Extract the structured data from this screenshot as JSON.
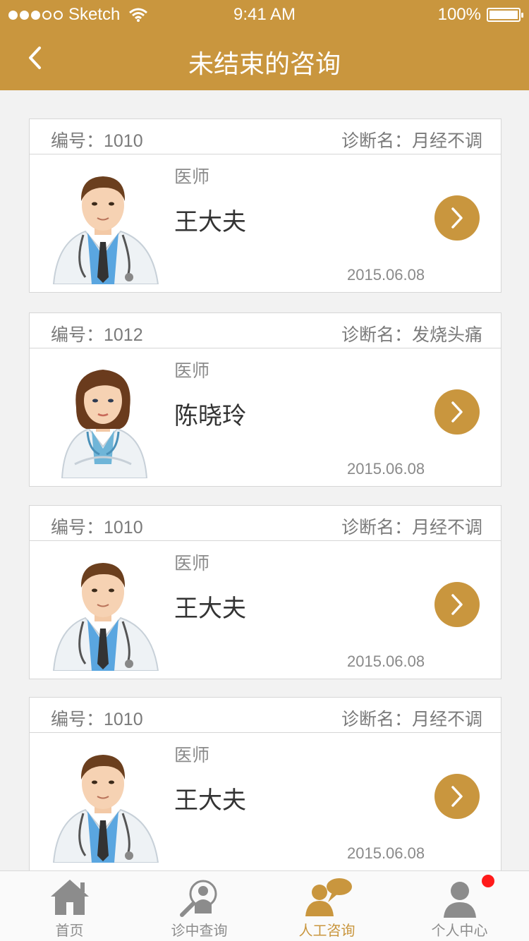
{
  "colors": {
    "accent": "#c9963e",
    "badge": "#ff1a1a",
    "background": "#f2f2f2"
  },
  "status_bar": {
    "carrier": "Sketch",
    "time": "9:41 AM",
    "battery": "100%"
  },
  "nav": {
    "title": "未结束的咨询",
    "back_icon": "chevron-left-icon"
  },
  "consultations": [
    {
      "id_label": "编号：1010",
      "diagnosis_label": "诊断名：月经不调",
      "role": "医师",
      "doctor_name": "王大夫",
      "date": "2015.06.08",
      "avatar": "male-doctor-avatar"
    },
    {
      "id_label": "编号：1012",
      "diagnosis_label": "诊断名：发烧头痛",
      "role": "医师",
      "doctor_name": "陈晓玲",
      "date": "2015.06.08",
      "avatar": "female-doctor-avatar"
    },
    {
      "id_label": "编号：1010",
      "diagnosis_label": "诊断名：月经不调",
      "role": "医师",
      "doctor_name": "王大夫",
      "date": "2015.06.08",
      "avatar": "male-doctor-avatar"
    },
    {
      "id_label": "编号：1010",
      "diagnosis_label": "诊断名：月经不调",
      "role": "医师",
      "doctor_name": "王大夫",
      "date": "2015.06.08",
      "avatar": "male-doctor-avatar"
    }
  ],
  "tabbar": {
    "tabs": [
      {
        "label": "首页",
        "icon": "home-icon",
        "active": false
      },
      {
        "label": "诊中查询",
        "icon": "search-person-icon",
        "active": false
      },
      {
        "label": "人工咨询",
        "icon": "chat-person-icon",
        "active": true
      },
      {
        "label": "个人中心",
        "icon": "user-icon",
        "active": false
      }
    ]
  }
}
